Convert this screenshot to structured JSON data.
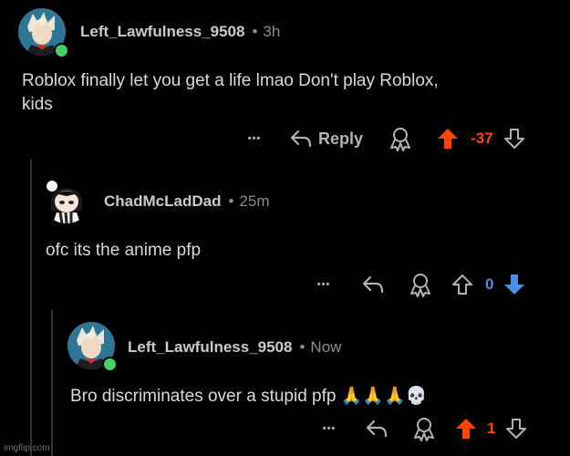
{
  "comments": [
    {
      "username": "Left_Lawfulness_9508",
      "separator": "•",
      "time": "3h",
      "body_line1": "Roblox finally let you get a life lmao Don't play Roblox,",
      "body_line2": "kids",
      "more": "•••",
      "reply_label": "Reply",
      "score": "-37",
      "vote": "upvoted",
      "online": true
    },
    {
      "username": "ChadMcLadDad",
      "separator": "•",
      "time": "25m",
      "body_line1": "ofc its the anime pfp",
      "more": "•••",
      "score": "0",
      "vote": "downvoted",
      "online": false
    },
    {
      "username": "Left_Lawfulness_9508",
      "separator": "•",
      "time": "Now",
      "body_line1": "Bro discriminates over a stupid pfp 🙏🙏🙏💀",
      "more": "•••",
      "score": "1",
      "vote": "upvoted",
      "online": true
    }
  ],
  "colors": {
    "upvote": "#ff4500",
    "downvote": "#4a90e2",
    "online": "#46d160",
    "background": "#000000"
  },
  "icons": [
    "more-icon",
    "reply-icon",
    "award-icon",
    "upvote-icon",
    "downvote-icon"
  ],
  "watermark": "imgflip.com"
}
